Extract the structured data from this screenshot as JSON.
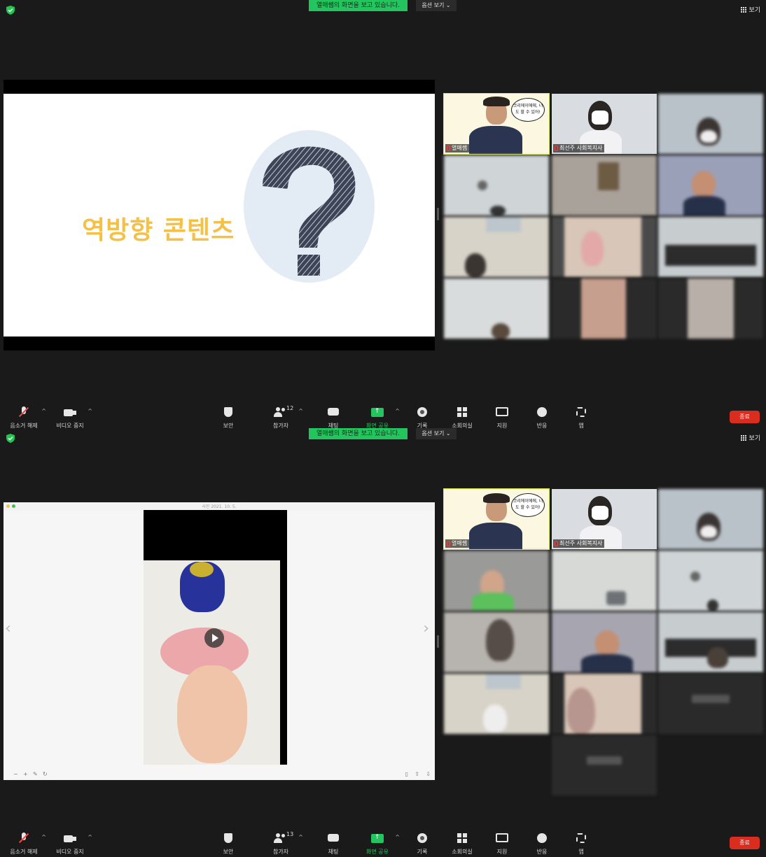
{
  "banner": {
    "sharing_text": "열매쌤의 화면을 보고 있습니다.",
    "options_label": "옵션 보기 ⌄",
    "view_label": "보기"
  },
  "slide": {
    "title": "역방향 콘텐츠"
  },
  "viewer": {
    "date_label": "사진 2021. 10. 5."
  },
  "participants": {
    "host_name": "열매쌤",
    "host_bubble": "코리에이에에, 너도 할 수 있어!",
    "second_name": "최선주 사회복지사"
  },
  "toolbar": {
    "unmute_label": "음소거 해제",
    "stop_video_label": "비디오 중지",
    "security_label": "보안",
    "participants_label": "참가자",
    "participants_count_1": "12",
    "participants_count_2": "13",
    "chat_label": "채팅",
    "share_label": "화면 공유",
    "record_label": "기록",
    "breakout_label": "소회의실",
    "remote_label": "지원",
    "reactions_label": "반응",
    "apps_label": "앱",
    "end_label": "종료"
  },
  "colors": {
    "banner_green": "#22c55e",
    "active_speaker": "#d3e64a",
    "end_red": "#d92d20",
    "slide_title": "#f4c146"
  }
}
